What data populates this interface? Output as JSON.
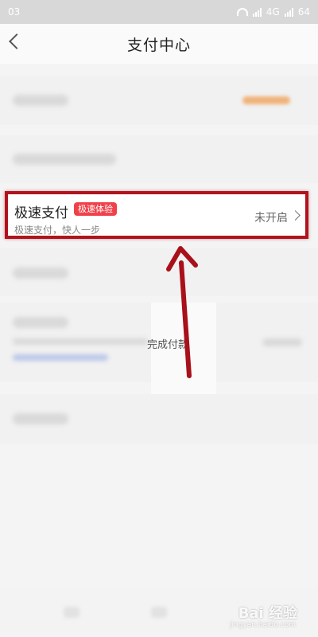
{
  "status_bar": {
    "time": "03",
    "network": "4G",
    "battery": "64"
  },
  "header": {
    "title": "支付中心"
  },
  "highlight_row": {
    "title": "极速支付",
    "badge": "极速体验",
    "subtitle": "极速支付，快人一步",
    "status": "未开启"
  },
  "middle_text": "完成付款",
  "watermark": {
    "brand": "Bai 经验",
    "sub": "jingyan.baidu.com"
  },
  "colors": {
    "highlight_border": "#b0131d",
    "badge_bg": "#f0414a",
    "arrow": "#a8101a"
  }
}
